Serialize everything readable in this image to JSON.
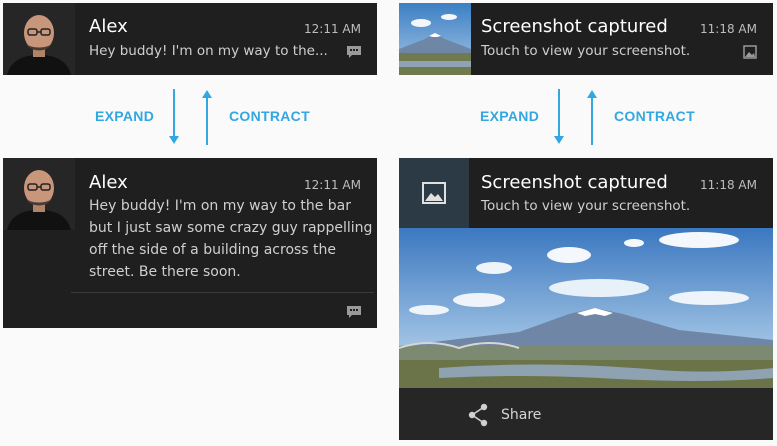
{
  "labels": {
    "expand": "EXPAND",
    "contract": "CONTRACT"
  },
  "alex_collapsed": {
    "sender": "Alex",
    "time": "12:11 AM",
    "preview": "Hey buddy! I'm on my way to the..."
  },
  "alex_expanded": {
    "sender": "Alex",
    "time": "12:11 AM",
    "lines": [
      "Hey buddy! I'm on my way to the bar",
      "but I just saw some crazy guy rappelling",
      "off the side of a building across the",
      "street. Be there soon."
    ]
  },
  "screenshot_collapsed": {
    "title": "Screenshot captured",
    "time": "11:18 AM",
    "text": "Touch to view your screenshot."
  },
  "screenshot_expanded": {
    "title": "Screenshot captured",
    "time": "11:18 AM",
    "text": "Touch to view your screenshot.",
    "action": "Share"
  },
  "icons": {
    "message": "message-icon",
    "image": "image-icon",
    "share": "share-icon",
    "arrow_down": "arrow-down-icon",
    "arrow_up": "arrow-up-icon"
  },
  "colors": {
    "notification_bg": "#1f1f1f",
    "label_accent": "#33a7e0",
    "icon_tile": "#2b3a44"
  }
}
